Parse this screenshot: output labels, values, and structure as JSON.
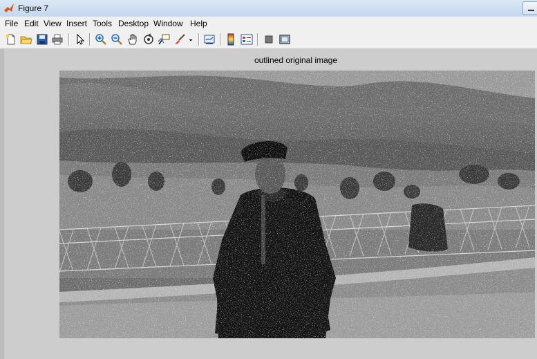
{
  "window": {
    "title": "Figure 7"
  },
  "menu": [
    "File",
    "Edit",
    "View",
    "Insert",
    "Tools",
    "Desktop",
    "Window",
    "Help"
  ],
  "toolbar": {
    "icons": [
      "new-figure-icon",
      "open-file-icon",
      "save-icon",
      "print-icon",
      "edit-plot-arrow-icon",
      "zoom-in-icon",
      "zoom-out-icon",
      "pan-hand-icon",
      "rotate-3d-icon",
      "data-cursor-icon",
      "brush-icon",
      "brush-dropdown-icon",
      "link-plot-icon",
      "insert-colorbar-icon",
      "insert-legend-icon",
      "hide-plot-tools-icon",
      "show-plot-tools-icon"
    ]
  },
  "axes": {
    "title": "outlined original image"
  },
  "colors": {
    "titlebar": "#c4d8ee",
    "background": "#cdcdcd",
    "menubar": "#f0f0f0"
  }
}
